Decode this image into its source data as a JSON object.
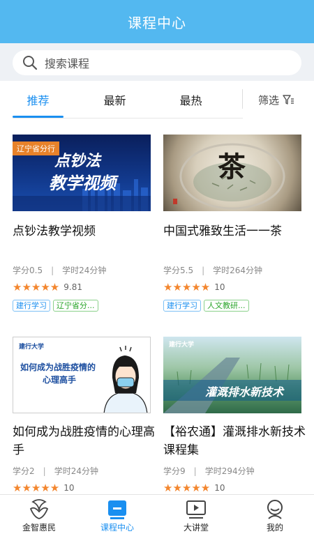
{
  "header": {
    "title": "课程中心"
  },
  "search": {
    "placeholder": "搜索课程"
  },
  "tabs": [
    {
      "label": "推荐",
      "active": true
    },
    {
      "label": "最新",
      "active": false
    },
    {
      "label": "最热",
      "active": false
    }
  ],
  "filter": {
    "label": "筛选"
  },
  "courses": [
    {
      "title": "点钞法教学视频",
      "credit": "学分0.5",
      "hours": "学时24分钟",
      "rating_stars": 5,
      "score": "9.81",
      "tags": [
        "建行学习",
        "辽宁省分..."
      ],
      "thumb": {
        "badge": "辽宁省分行",
        "line1": "点钞法",
        "line2": "教学视频"
      }
    },
    {
      "title": "中国式雅致生活一一茶",
      "credit": "学分5.5",
      "hours": "学时264分钟",
      "rating_stars": 5,
      "score": "10",
      "tags": [
        "建行学习",
        "人文教研..."
      ],
      "thumb": {
        "char": "茶"
      }
    },
    {
      "title": "如何成为战胜疫情的心理高手",
      "credit": "学分2",
      "hours": "学时24分钟",
      "rating_stars": 5,
      "score": "10",
      "tags": [],
      "thumb": {
        "line1": "如何成为战胜疫情的",
        "line2": "心理高手",
        "logo": "建行大学"
      }
    },
    {
      "title": "【裕农通】灌溉排水新技术课程集",
      "credit": "学分9",
      "hours": "学时294分钟",
      "rating_stars": 5,
      "score": "10",
      "tags": [],
      "thumb": {
        "caption": "灌溉排水新技术",
        "logo": "建行大学"
      }
    }
  ],
  "bottom_nav": [
    {
      "label": "金智惠民",
      "icon": "jinzhi-logo-icon",
      "active": false
    },
    {
      "label": "课程中心",
      "icon": "course-center-icon",
      "active": true
    },
    {
      "label": "大讲堂",
      "icon": "lecture-hall-icon",
      "active": false
    },
    {
      "label": "我的",
      "icon": "profile-icon",
      "active": false
    }
  ],
  "colors": {
    "accent": "#1a8ff0",
    "header": "#53b8f0",
    "star": "#f3862e"
  }
}
